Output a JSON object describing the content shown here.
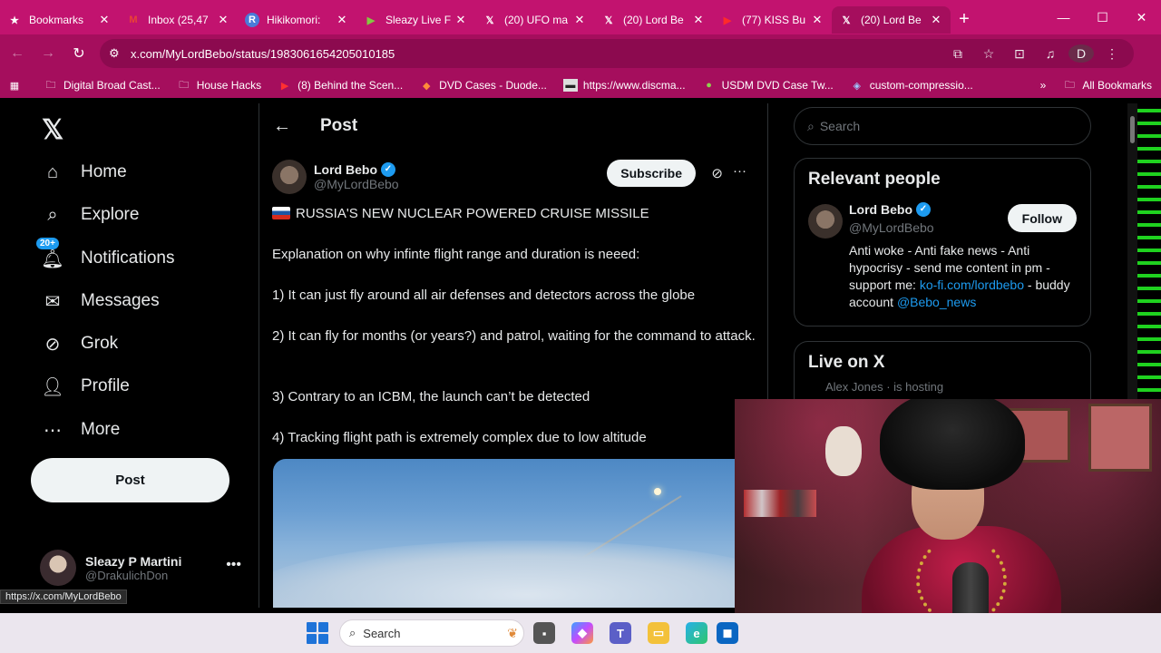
{
  "browser": {
    "tabs": [
      {
        "title": "Bookmarks",
        "icon": "star-icon",
        "active": false
      },
      {
        "title": "Inbox (25,47",
        "icon": "gmail-icon",
        "active": false
      },
      {
        "title": "Hikikomori:",
        "icon": "r-icon",
        "active": false
      },
      {
        "title": "Sleazy Live F",
        "icon": "rumble-icon",
        "active": false
      },
      {
        "title": "(20) UFO ma",
        "icon": "x-icon",
        "active": false
      },
      {
        "title": "(20) Lord Be",
        "icon": "x-icon",
        "active": false
      },
      {
        "title": "(77) KISS Bu",
        "icon": "youtube-icon",
        "active": false
      },
      {
        "title": "(20) Lord Be",
        "icon": "x-icon",
        "active": true
      }
    ],
    "url": "x.com/MyLordBebo/status/1983061654205010185",
    "profile_initial": "D",
    "bookmarks": [
      {
        "label": "Digital Broad Cast...",
        "icon": "folder-icon"
      },
      {
        "label": "House Hacks",
        "icon": "folder-icon"
      },
      {
        "label": "(8) Behind the Scen...",
        "icon": "youtube-icon"
      },
      {
        "label": "DVD Cases - Duode...",
        "icon": "site-icon"
      },
      {
        "label": "https://www.discma...",
        "icon": "site-icon"
      },
      {
        "label": "USDM DVD Case Tw...",
        "icon": "site-icon"
      },
      {
        "label": "custom-compressio...",
        "icon": "site-icon"
      }
    ],
    "all_bookmarks": "All Bookmarks"
  },
  "nav": {
    "items": [
      {
        "label": "Home",
        "icon": "home-icon"
      },
      {
        "label": "Explore",
        "icon": "search-icon"
      },
      {
        "label": "Notifications",
        "icon": "bell-icon",
        "badge": "20+"
      },
      {
        "label": "Messages",
        "icon": "mail-icon"
      },
      {
        "label": "Grok",
        "icon": "grok-icon"
      },
      {
        "label": "Profile",
        "icon": "person-icon"
      },
      {
        "label": "More",
        "icon": "more-circle-icon"
      }
    ],
    "post_button": "Post",
    "account": {
      "name": "Sleazy P Martini",
      "handle": "@DrakulichDon"
    }
  },
  "post": {
    "header": "Post",
    "author_name": "Lord Bebo",
    "author_handle": "@MyLordBebo",
    "subscribe_label": "Subscribe",
    "headline": "RUSSIA'S NEW NUCLEAR POWERED CRUISE MISSILE",
    "paragraphs": [
      "Explanation on why infinte flight range and duration is neeed:",
      "1) It can just fly around all air defenses and detectors across the globe",
      "2) It can fly for months (or years?) and patrol, waiting for the command to attack.",
      "3) Contrary to an ICBM, the launch can’t be detected",
      "4) Tracking flight path is extremely complex due to low altitude"
    ]
  },
  "sidebar": {
    "search_placeholder": "Search",
    "relevant_title": "Relevant people",
    "person": {
      "name": "Lord Bebo",
      "handle": "@MyLordBebo",
      "follow_label": "Follow",
      "bio_text": "Anti woke - Anti fake news - Anti hypocrisy - send me content in pm - support me:",
      "bio_link": "ko-fi.com/lordbebo",
      "bio_mid": "- buddy account",
      "bio_mention": "@Bebo_news"
    },
    "live_title": "Live on X",
    "live_sub": "Alex Jones · is hosting"
  },
  "status_link": "https://x.com/MyLordBebo",
  "taskbar": {
    "search_placeholder": "Search"
  },
  "colors": {
    "chrome_tab": "#c2136f",
    "chrome_bar": "#a50e5d",
    "accent": "#1d9bf0",
    "bg": "#000000"
  }
}
